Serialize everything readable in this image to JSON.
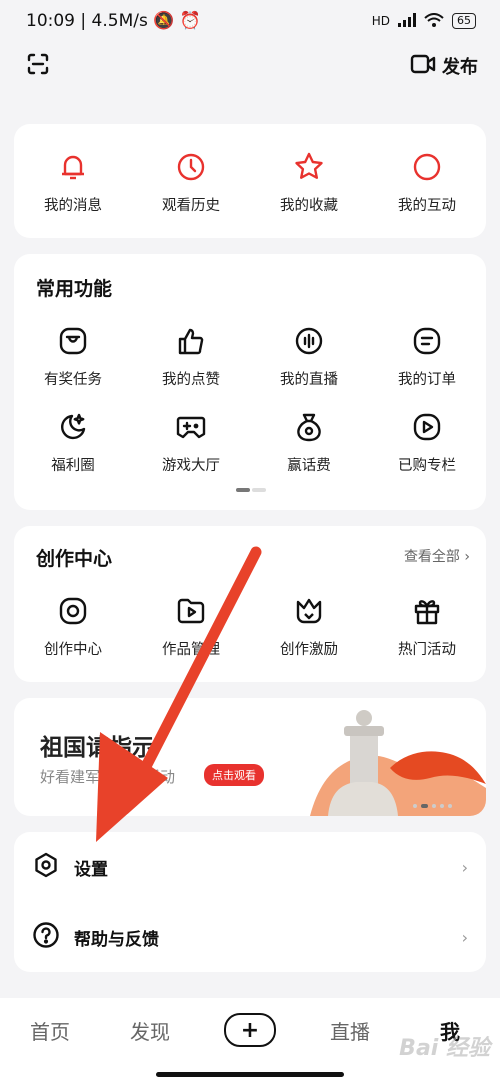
{
  "status_bar": {
    "time": "10:09",
    "speed": "4.5M/s",
    "signal": "HD",
    "battery": "65"
  },
  "header": {
    "publish_label": "发布"
  },
  "quick_actions": [
    {
      "label": "我的消息",
      "icon": "bell-icon"
    },
    {
      "label": "观看历史",
      "icon": "clock-icon"
    },
    {
      "label": "我的收藏",
      "icon": "star-icon"
    },
    {
      "label": "我的互动",
      "icon": "circle-icon"
    }
  ],
  "common": {
    "title": "常用功能",
    "items": [
      {
        "label": "有奖任务",
        "icon": "task-icon"
      },
      {
        "label": "我的点赞",
        "icon": "thumb-up-icon"
      },
      {
        "label": "我的直播",
        "icon": "live-icon"
      },
      {
        "label": "我的订单",
        "icon": "order-icon"
      },
      {
        "label": "福利圈",
        "icon": "moon-star-icon"
      },
      {
        "label": "游戏大厅",
        "icon": "gamepad-icon"
      },
      {
        "label": "赢话费",
        "icon": "money-bag-icon"
      },
      {
        "label": "已购专栏",
        "icon": "play-icon"
      }
    ]
  },
  "creation": {
    "title": "创作中心",
    "more": "查看全部",
    "items": [
      {
        "label": "创作中心",
        "icon": "camera-icon"
      },
      {
        "label": "作品管理",
        "icon": "folder-play-icon"
      },
      {
        "label": "创作激励",
        "icon": "crown-icon"
      },
      {
        "label": "热门活动",
        "icon": "gift-icon"
      }
    ]
  },
  "banner": {
    "title": "祖国请指示",
    "subtitle": "好看建军主题月活动",
    "button": "点击观看"
  },
  "menu": [
    {
      "label": "设置",
      "icon": "settings-hexagon-icon"
    },
    {
      "label": "帮助与反馈",
      "icon": "help-icon"
    }
  ],
  "tabbar": {
    "home": "首页",
    "discover": "发现",
    "create": "+",
    "live": "直播",
    "me": "我"
  },
  "watermark": "Bai 经验",
  "colors": {
    "accent": "#e8322e",
    "arrow": "#e8422a"
  }
}
